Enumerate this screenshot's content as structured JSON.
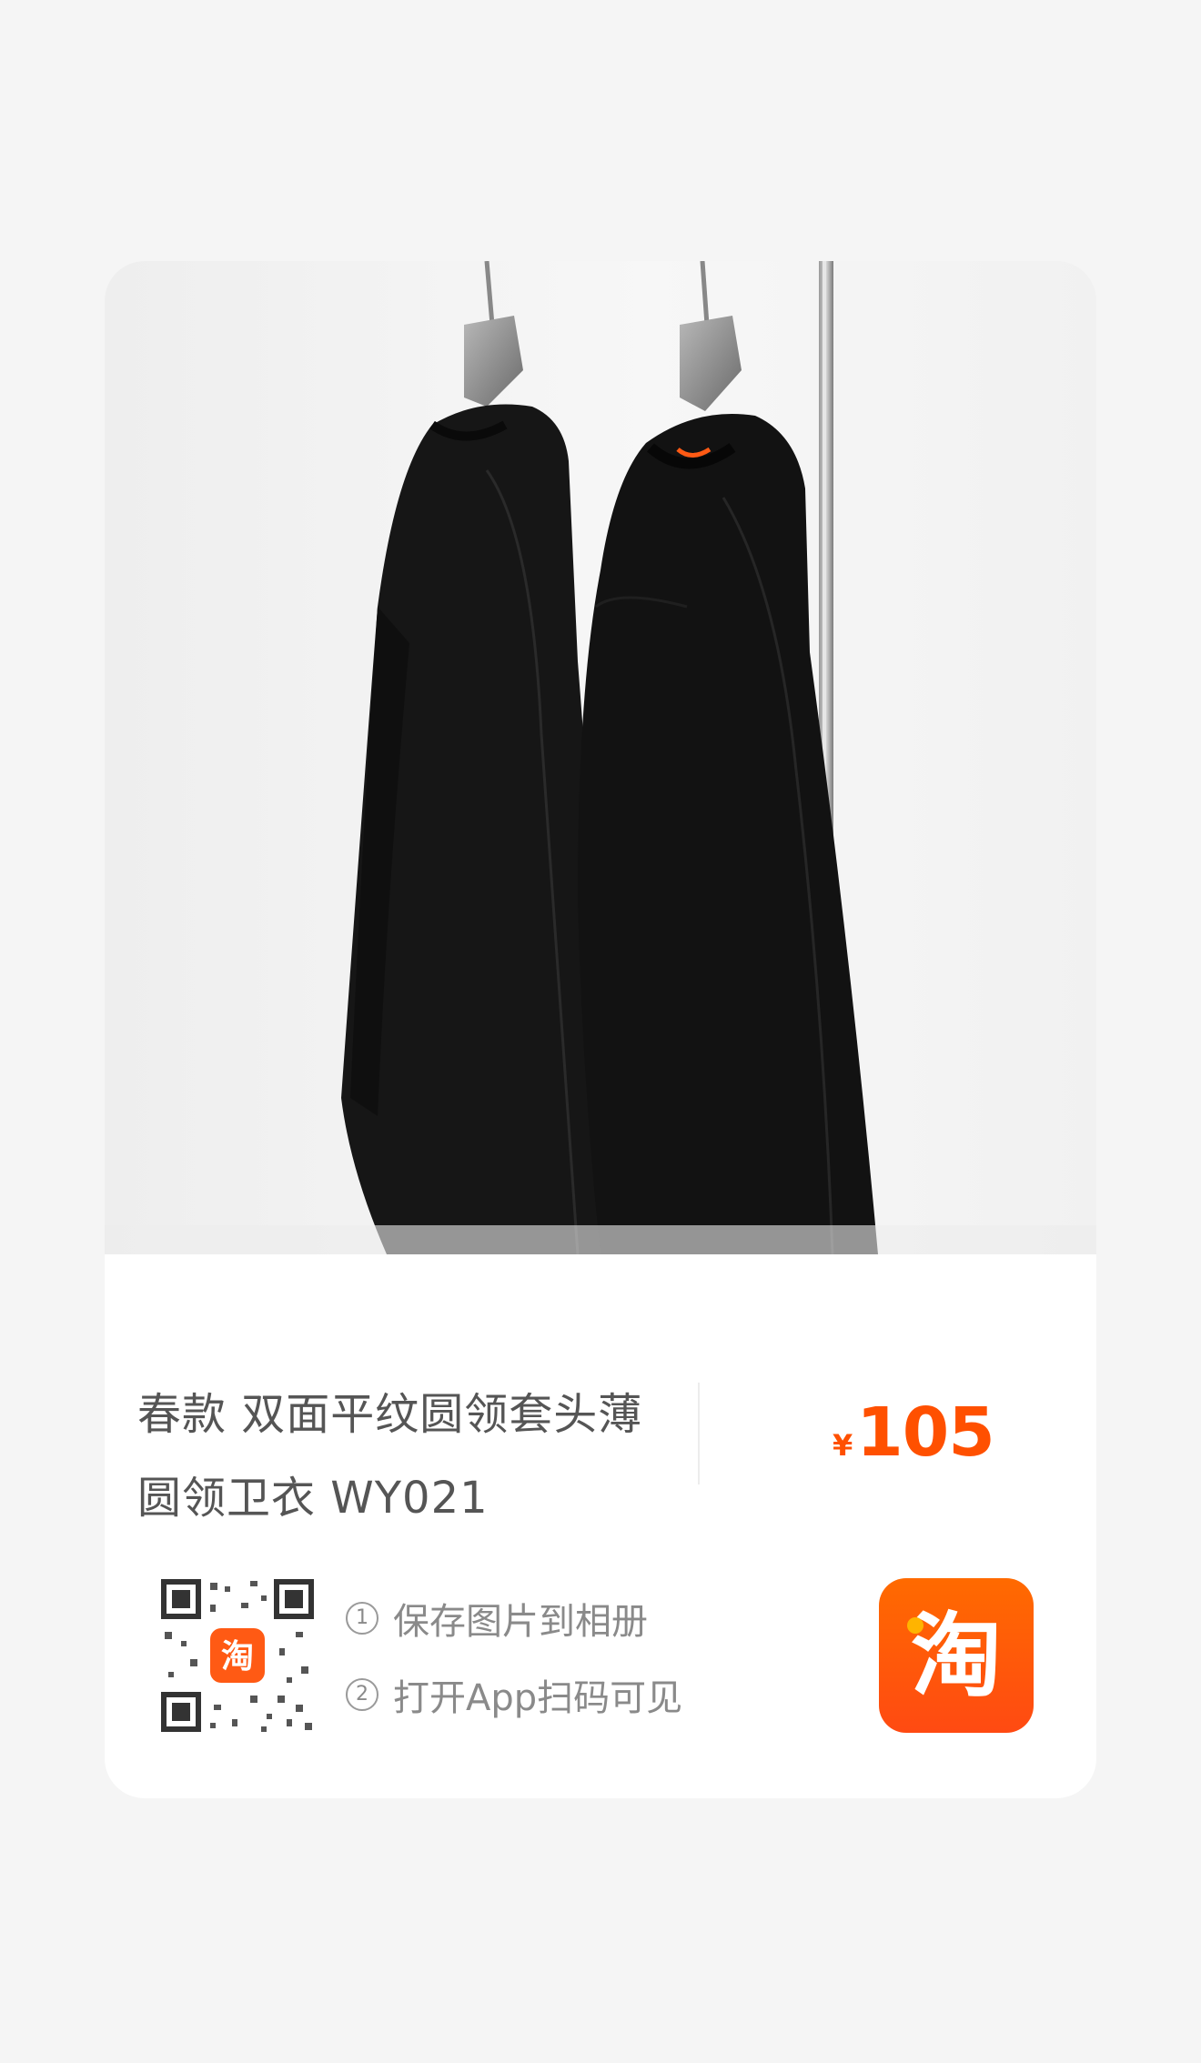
{
  "product": {
    "title_line1": "春款 双面平纹圆领套头薄",
    "title_line2": "圆领卫衣 WY021",
    "price_currency": "¥",
    "price_amount": "105",
    "image_description": "two black crewneck sweatshirts on hangers"
  },
  "share": {
    "step1_num": "1",
    "step1_text": "保存图片到相册",
    "step2_num": "2",
    "step2_text": "打开App扫码可见",
    "qr_badge_icon": "taobao-logo-icon",
    "app_icon": "taobao-logo-icon"
  },
  "colors": {
    "accent": "#ff5000",
    "background": "#f5f5f5",
    "card": "#ffffff"
  }
}
